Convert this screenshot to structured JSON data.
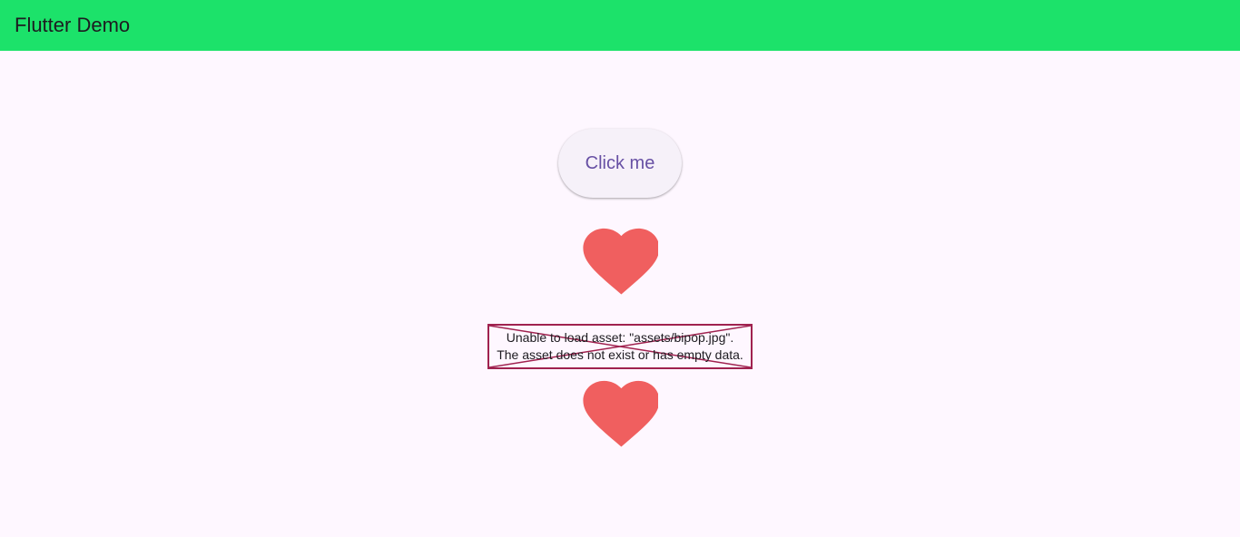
{
  "appbar": {
    "title": "Flutter Demo",
    "color": "#1ce26a"
  },
  "main": {
    "button_label": "Click me",
    "heart_color": "#f05f5f",
    "icons": [
      "heart-icon",
      "heart-icon"
    ],
    "image_error": {
      "line1": "Unable to load asset: \"assets/bipop.jpg\".",
      "line2": "The asset does not exist or has empty data.",
      "border_color": "#a0224f"
    }
  }
}
